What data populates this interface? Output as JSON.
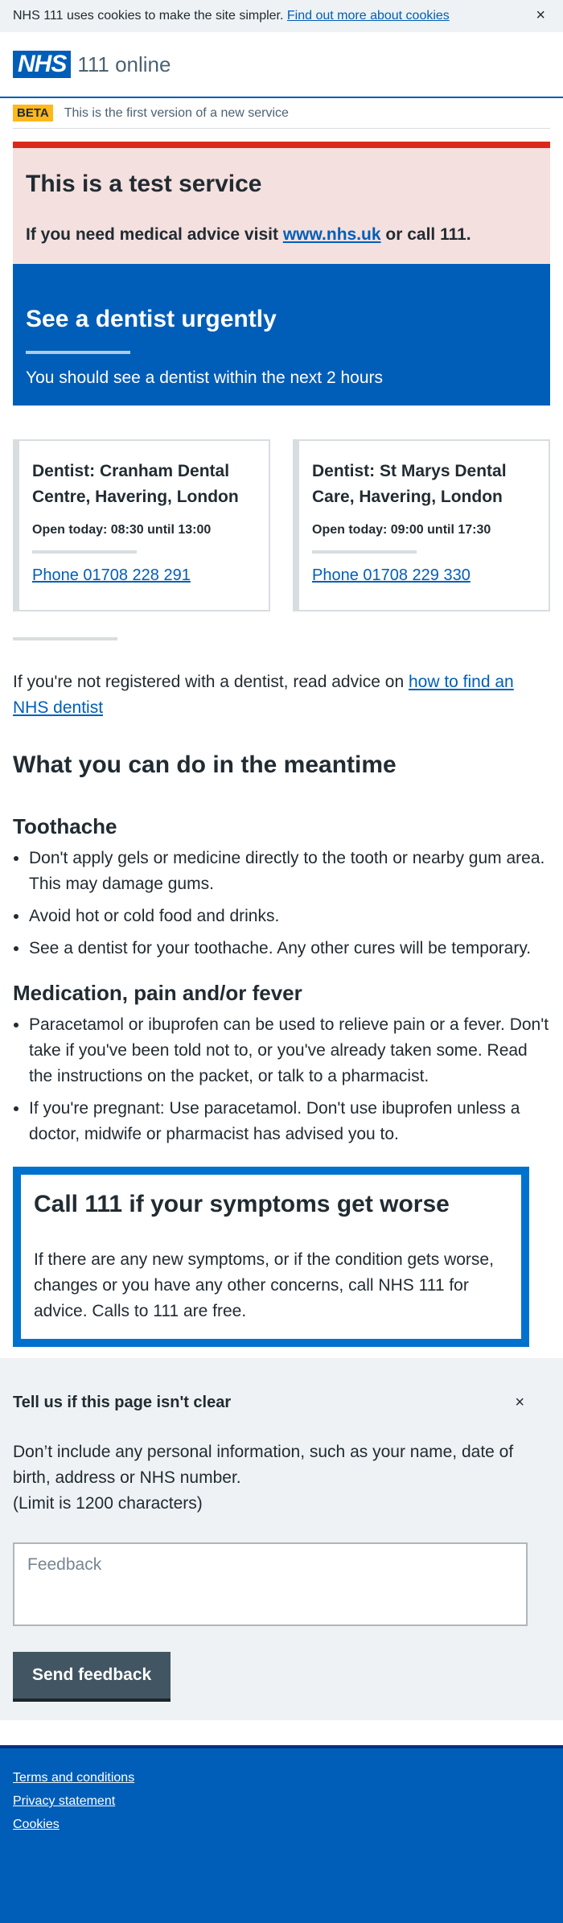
{
  "cookie": {
    "text": "NHS 111 uses cookies to make the site simpler.",
    "link": "Find out more about cookies",
    "close": "×"
  },
  "header": {
    "logo": "NHS",
    "service": "111 online"
  },
  "beta": {
    "tag": "BETA",
    "text": "This is the first version of a new service"
  },
  "test_banner": {
    "title": "This is a test service",
    "text_before": "If you need medical advice visit",
    "link": "www.nhs.uk",
    "text_after": "or call 111."
  },
  "hero": {
    "title": "See a dentist urgently",
    "subtitle": "You should see a dentist within the next 2 hours"
  },
  "services": [
    {
      "name": "Dentist: Cranham Dental Centre, Havering, London",
      "hours": "Open today: 08:30 until 13:00",
      "phone": "Phone 01708 228 291"
    },
    {
      "name": "Dentist: St Marys Dental Care, Havering, London",
      "hours": "Open today: 09:00 until 17:30",
      "phone": "Phone 01708 229 330"
    }
  ],
  "not_registered": {
    "text": "If you're not registered with a dentist, read advice on",
    "link": "how to find an NHS dentist"
  },
  "meantime": {
    "title": "What you can do in the meantime",
    "toothache": {
      "title": "Toothache",
      "items": [
        "Don't apply gels or medicine directly to the tooth or nearby gum area. This may damage gums.",
        "Avoid hot or cold food and drinks.",
        "See a dentist for your toothache. Any other cures will be temporary."
      ]
    },
    "medication": {
      "title": "Medication, pain and/or fever",
      "items": [
        "Paracetamol or ibuprofen can be used to relieve pain or a fever. Don't take if you've been told not to, or you've already taken some. Read the instructions on the packet, or talk to a pharmacist.",
        "If you're pregnant: Use paracetamol. Don't use ibuprofen unless a doctor, midwife or pharmacist has advised you to."
      ]
    }
  },
  "callout": {
    "title": "Call 111 if your symptoms get worse",
    "text": "If there are any new symptoms, or if the condition gets worse, changes or you have any other concerns, call NHS 111 for advice. Calls to 111 are free."
  },
  "feedback": {
    "title": "Tell us if this page isn't clear",
    "close": "×",
    "text": "Don’t include any personal information, such as your name, date of birth, address or NHS number.",
    "limit": "(Limit is 1200 characters)",
    "placeholder": "Feedback",
    "button": "Send feedback"
  },
  "footer": {
    "links": [
      "Terms and conditions",
      "Privacy statement",
      "Cookies"
    ]
  },
  "colors": {
    "nhs_blue": "#005eb8",
    "bright_blue": "#0072ce",
    "red": "#da291c",
    "yellow": "#ffb81c"
  }
}
